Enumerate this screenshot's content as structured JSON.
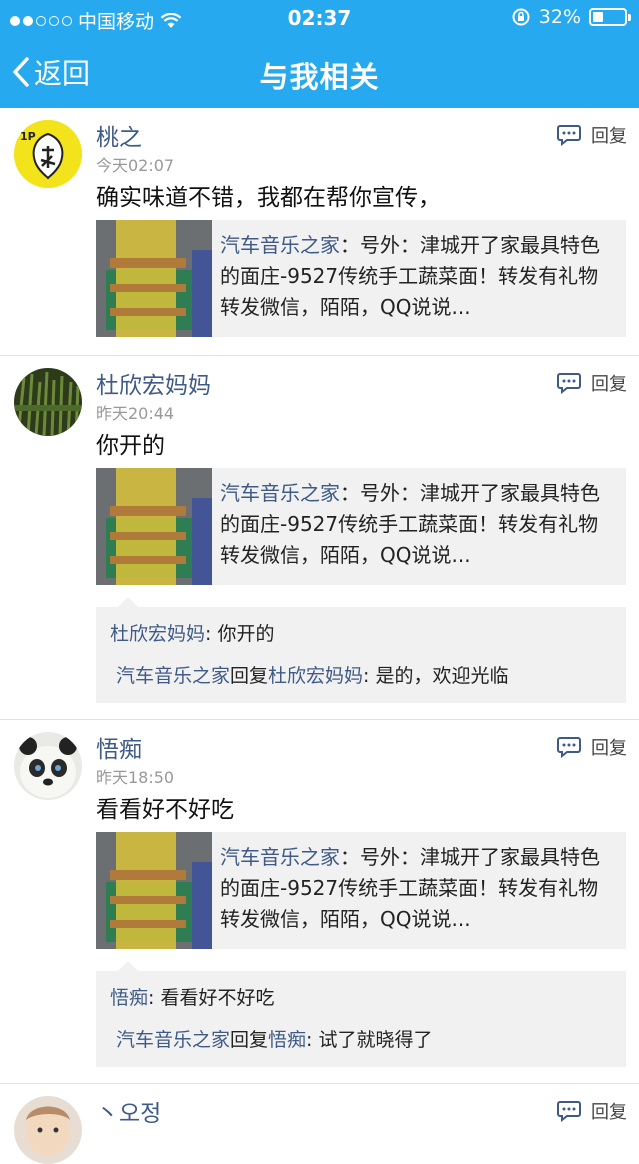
{
  "status": {
    "carrier": "中国移动",
    "time": "02:37",
    "battery": "32%",
    "battery_level": 0.32
  },
  "nav": {
    "back_label": "返回",
    "title": "与我相关"
  },
  "reply_label": "回复",
  "card": {
    "source": "汽车音乐之家",
    "sep": "：",
    "text": "号外：津城开了家最具特色的面庄-9527传统手工蔬菜面！转发有礼物转发微信，陌陌，QQ说说..."
  },
  "items": [
    {
      "name": "桃之",
      "time": "今天02:07",
      "text": "确实味道不错，我都在帮你宣传，",
      "avatar_text": "1P"
    },
    {
      "name": "杜欣宏妈妈",
      "time": "昨天20:44",
      "text": "你开的",
      "thread": [
        {
          "a": "杜欣宏妈妈",
          "mid": "",
          "b": "",
          "colon": ": ",
          "msg": "你开的"
        },
        {
          "a": "汽车音乐之家",
          "mid": "回复",
          "b": "杜欣宏妈妈",
          "colon": ": ",
          "msg": "是的，欢迎光临"
        }
      ]
    },
    {
      "name": "悟痴",
      "time": "昨天18:50",
      "text": "看看好不好吃",
      "thread": [
        {
          "a": "悟痴",
          "mid": "",
          "b": "",
          "colon": ": ",
          "msg": "看看好不好吃"
        },
        {
          "a": "汽车音乐之家",
          "mid": "回复",
          "b": "悟痴",
          "colon": ": ",
          "msg": "试了就晓得了"
        }
      ]
    },
    {
      "name": "丶오정"
    }
  ],
  "colors": {
    "accent": "#26a9ee",
    "name": "#3f5a86"
  }
}
